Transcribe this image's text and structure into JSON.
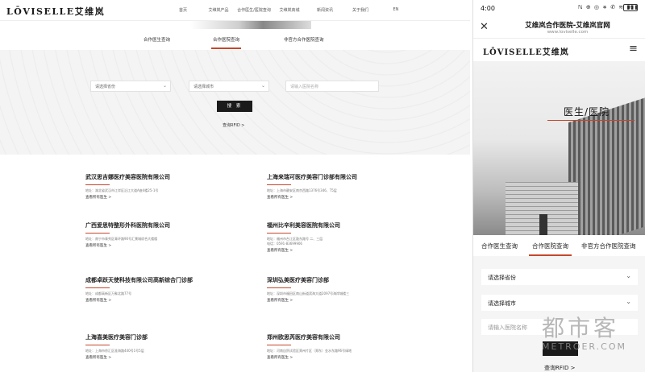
{
  "desktop": {
    "logo": "LŌVISELLE艾维岚",
    "menu": [
      "首页",
      "艾维岚产品",
      "合作医生/医院查询",
      "艾维岚商城",
      "新闻资讯",
      "关于我们",
      "EN"
    ],
    "tabs": [
      "合作医生查询",
      "合作医院查询",
      "非官方合作医院查询"
    ],
    "search": {
      "province": "请选择省份",
      "city": "请选择城市",
      "hospital_placeholder": "请输入医院名称",
      "button": "搜 索",
      "rfid": "查询RFID  >"
    },
    "hospitals": [
      {
        "name": "武汉思吉娜医疗美容医院有限公司",
        "addr": "地址：湖北省武汉市江岸区沿江大道A座4楼25-1号",
        "link": "查看所有医生  >"
      },
      {
        "name": "上海来瑞可医疗美容门诊部有限公司",
        "addr": "地址：上海市静安区南京西路1376号346、T5层",
        "link": "查看所有医生  >"
      },
      {
        "name": "广西爱思特整形外科医院有限公司",
        "addr": "地址：南宁市青秀区青环路90号汇景城综合大楼楼",
        "link": "查看所有医生  >"
      },
      {
        "name": "福州比辛利美容医院有限公司",
        "addr": "地址：福州市台江区鼓东路号 二、三层",
        "phone": "电话：0591-83699906",
        "link": "查看所有医生  >"
      },
      {
        "name": "成都卓跃天使科技有限公司高新综合门诊部",
        "addr": "地址：成都高新区万象北路77号",
        "link": "查看所有医生  >"
      },
      {
        "name": "深圳弘美医疗美容门诊部",
        "addr": "地址：深圳市福田区南山街道滨海大道2097号海岸城楼三",
        "link": "查看所有医生  >"
      },
      {
        "name": "上海喜美医疗美容门诊部",
        "addr": "地址：上海市徐汇区淮海路440号1号5层",
        "link": "查看所有医生  >"
      },
      {
        "name": "郑州欧思芮医疗美容有限公司",
        "addr": "地址：河南自贸试验区郑州片区（郑东）金水东路96号绿地",
        "link": "查看所有医生  >"
      }
    ]
  },
  "mobile": {
    "status": {
      "time": "4:00",
      "icons": "ℕ ⊕ ◎ ∗ ✆ ≋ ▮▮▮",
      "battery": "95"
    },
    "page_title": "艾维岚合作医院-艾维岚官网",
    "page_url": "www.loviselle.com",
    "logo": "LŌVISELLE艾维岚",
    "hero_title": "医生/医院",
    "tabs": [
      "合作医生查询",
      "合作医院查询",
      "非官方合作医院查询"
    ],
    "form": {
      "province": "请选择省份",
      "city": "请选择城市",
      "hospital_placeholder": "请输入医院名称",
      "rfid": "查询RFID  >"
    }
  },
  "watermark": {
    "cn": "都市客",
    "en": "METROER.COM"
  },
  "colors": {
    "accent": "#c5472a",
    "button": "#1b1b1b"
  }
}
